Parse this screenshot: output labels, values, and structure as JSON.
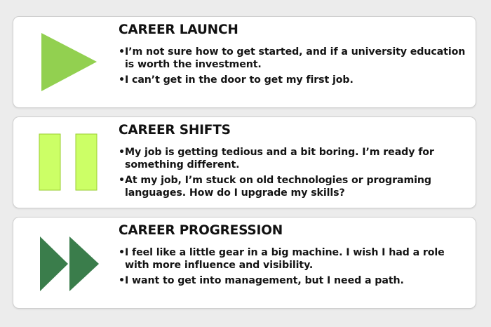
{
  "colors": {
    "launch_icon": "#92d050",
    "shifts_icon": "#ccff66",
    "shifts_icon_border": "#9acd32",
    "progression_icon": "#3a7d4b"
  },
  "sections": [
    {
      "icon": "play-icon",
      "title": "CAREER LAUNCH",
      "bullets": [
        "I’m not sure how to get started, and if a university education is worth the investment.",
        "I can’t get in the door to get my first job."
      ]
    },
    {
      "icon": "pause-icon",
      "title": "CAREER SHIFTS",
      "bullets": [
        "My job is getting tedious and a bit boring.  I’m ready for something different.",
        "At my job, I’m stuck on old technologies or programing languages.  How do I upgrade my skills?"
      ]
    },
    {
      "icon": "fast-forward-icon",
      "title": "CAREER PROGRESSION",
      "bullets": [
        "I feel like a little gear in a big machine.  I wish I had a role with more influence and visibility.",
        "I want to get into management, but I need a path."
      ]
    }
  ]
}
